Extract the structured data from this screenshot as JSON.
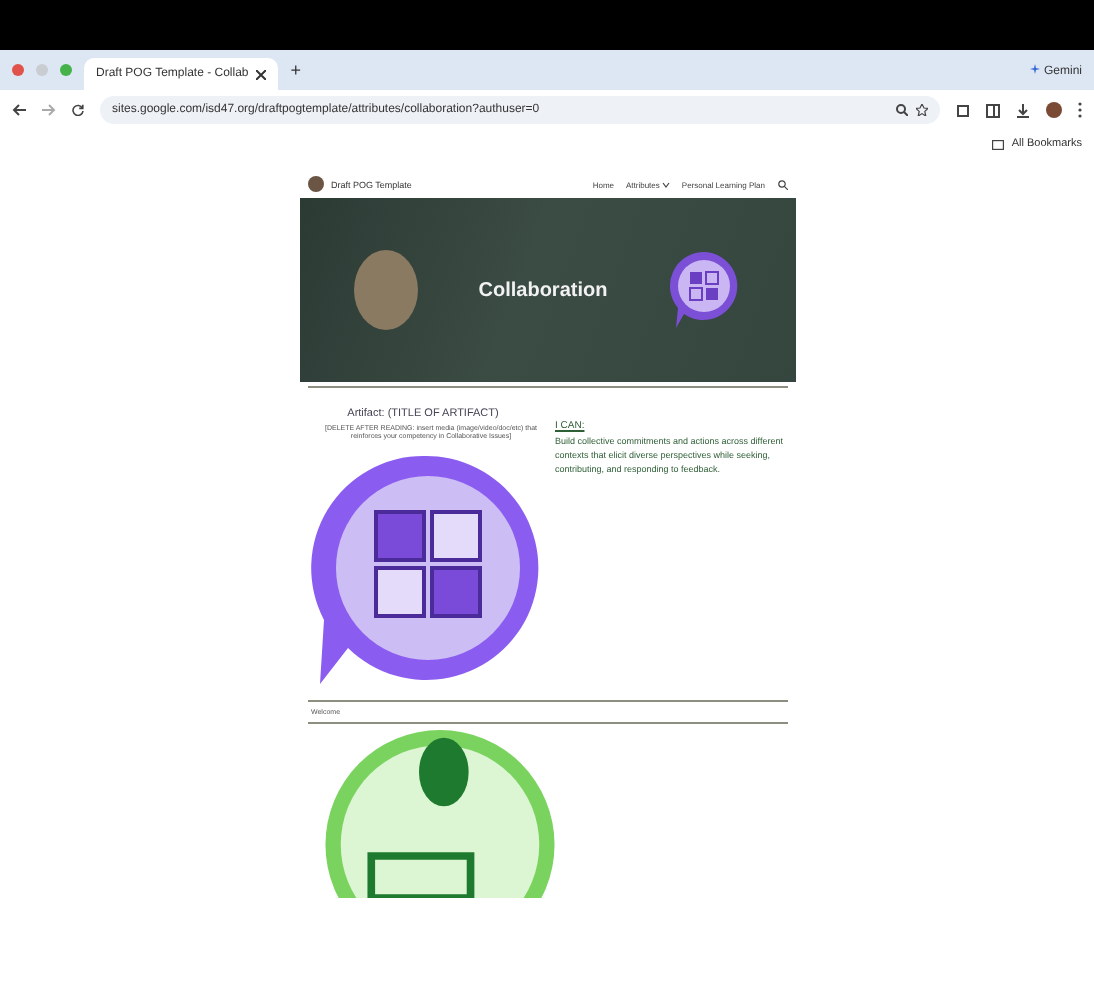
{
  "browser": {
    "tab_title": "Draft POG Template - Collab",
    "new_tab": "+",
    "gemini": "Gemini",
    "url": "sites.google.com/isd47.org/draftpogtemplate/attributes/collaboration?authuser=0",
    "bookmarks": "All Bookmarks"
  },
  "site": {
    "title": "Draft POG Template",
    "nav": [
      {
        "label": "Home",
        "kind": "link"
      },
      {
        "label": "Attributes",
        "kind": "menu"
      },
      {
        "label": "Personal Learning Plan",
        "kind": "link"
      }
    ]
  },
  "banner": {
    "title": "Collaboration"
  },
  "artifact": {
    "title": "Artifact: (TITLE OF ARTIFACT)",
    "note": "[DELETE AFTER READING: insert media (image/video/doc/etc) that reinforces your competency in Collaborative Issues]"
  },
  "i_can": {
    "heading": "I CAN:",
    "text": "Build collective commitments and actions across different contexts that elicit diverse perspectives while seeking, contributing, and responding to feedback."
  },
  "section": {
    "label": "Welcome"
  }
}
